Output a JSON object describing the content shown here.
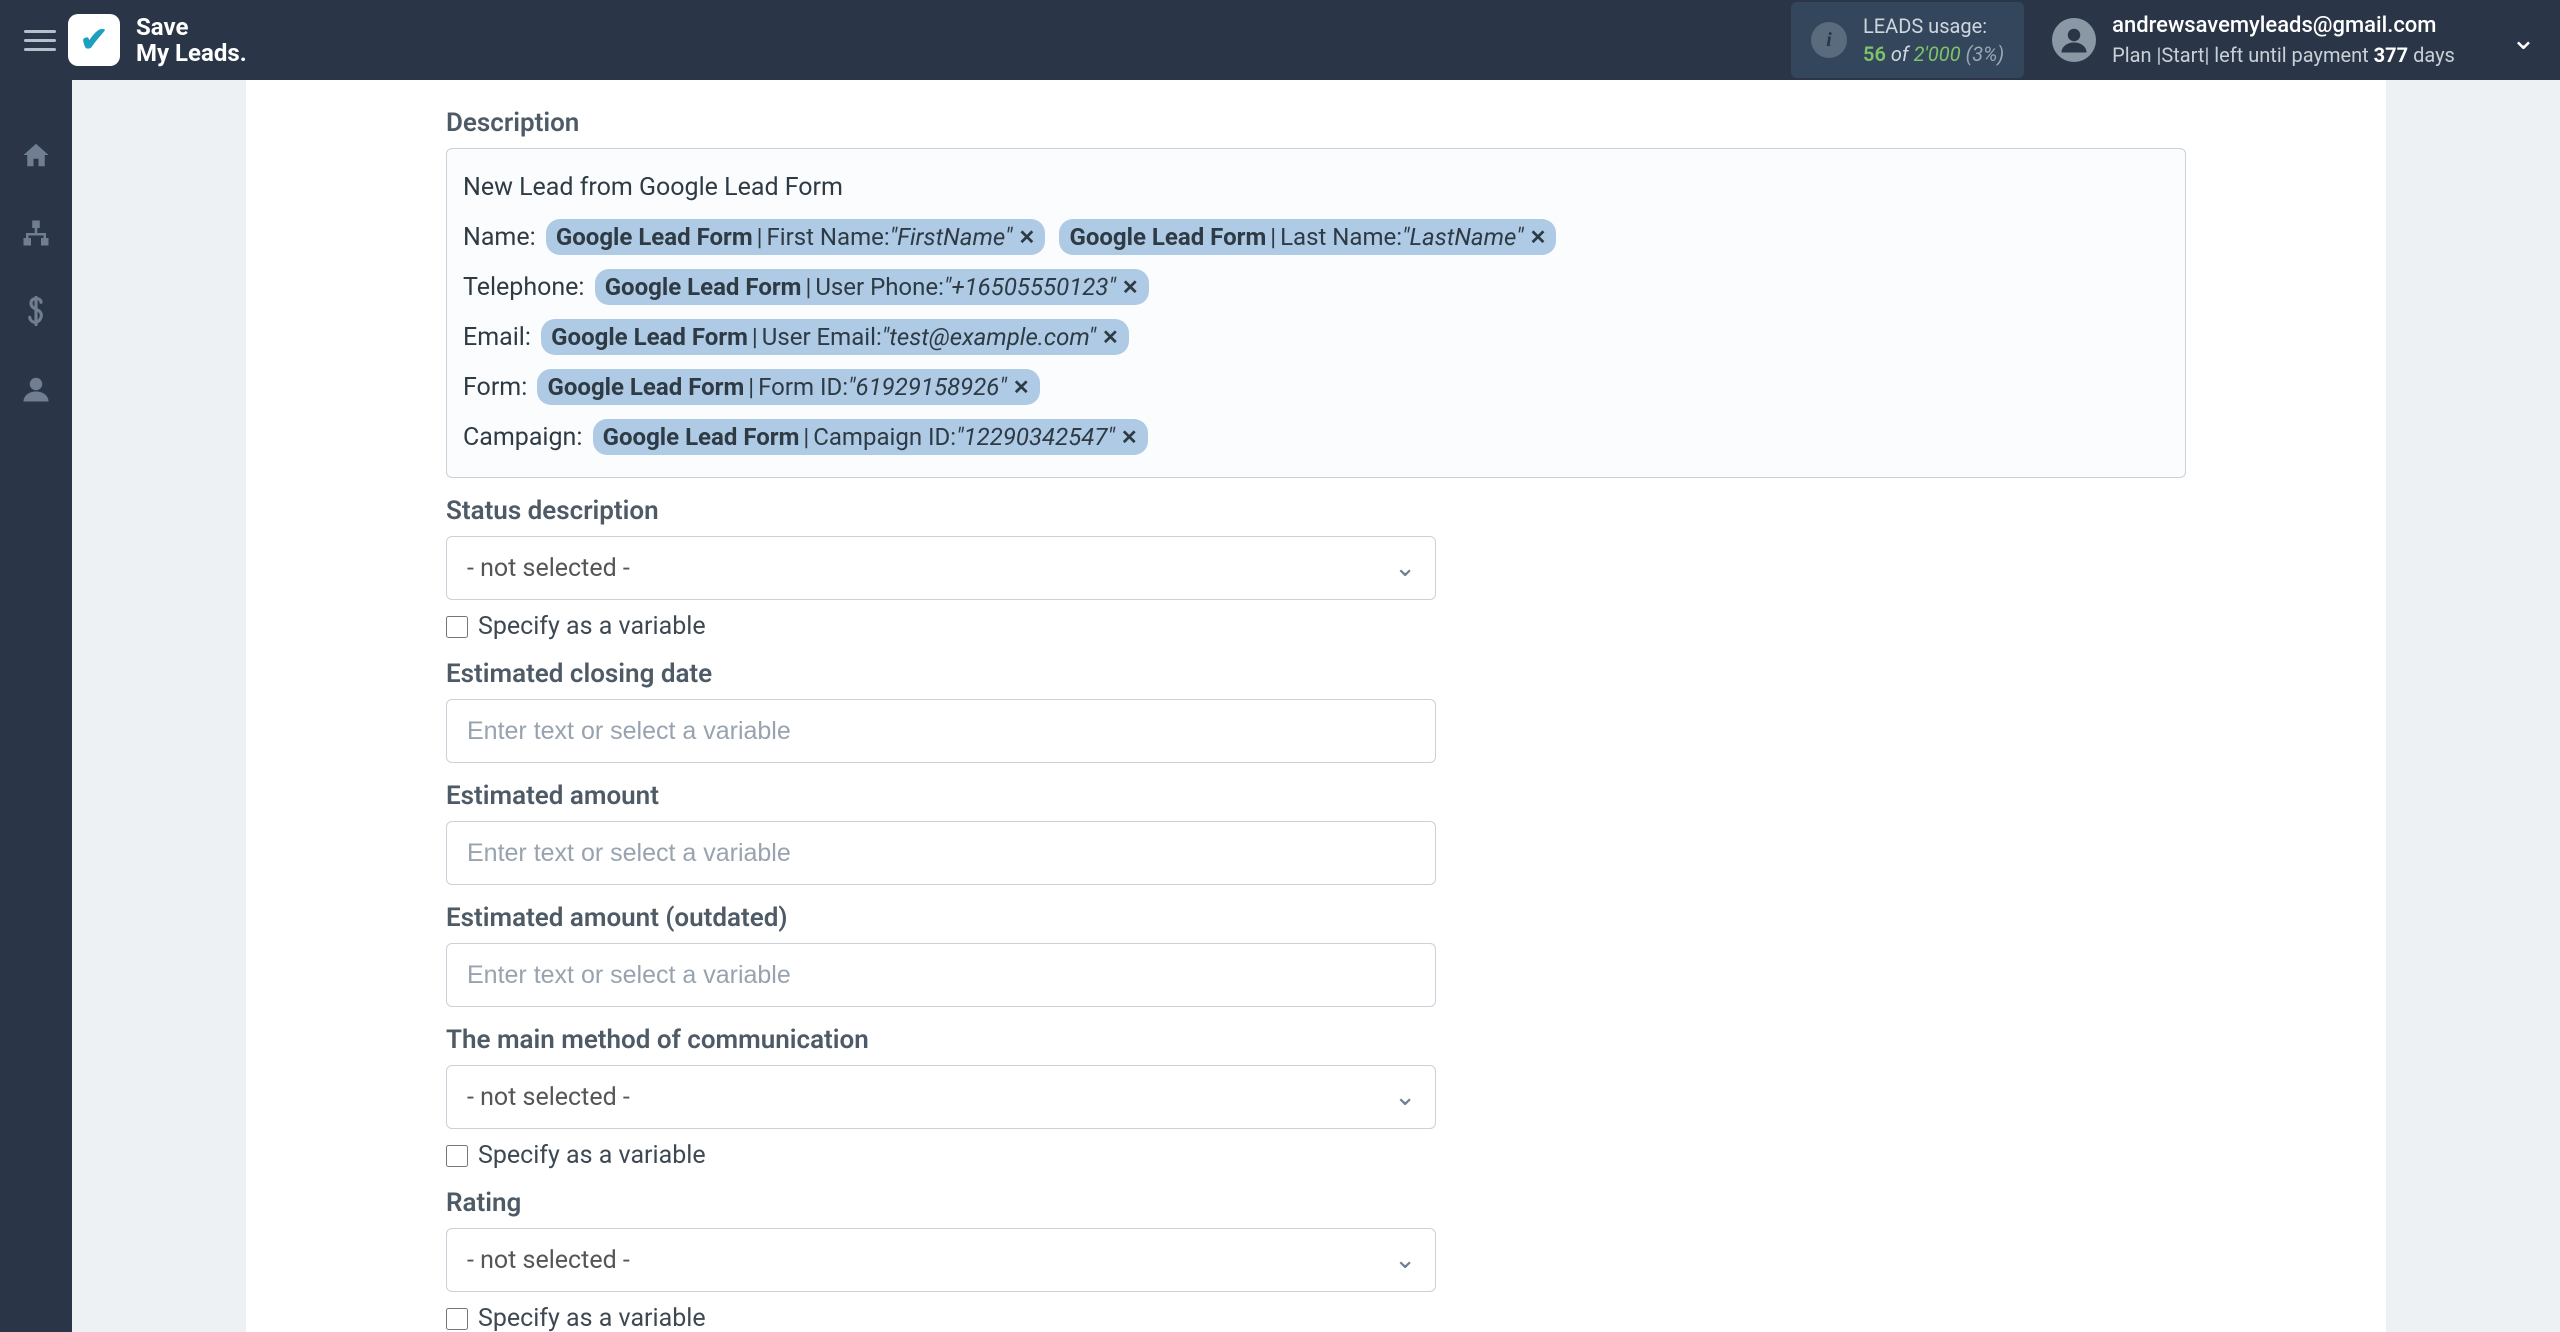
{
  "brand": {
    "line1": "Save",
    "line2": "My Leads."
  },
  "leads_usage": {
    "title": "LEADS usage:",
    "used": "56",
    "of_word": "of",
    "total": "2'000",
    "pct": "(3%)"
  },
  "user": {
    "email": "andrewsavemyleads@gmail.com",
    "plan_prefix": "Plan |Start| left until payment",
    "days": "377",
    "days_suffix": "days"
  },
  "description": {
    "label": "Description",
    "lead_line": "New Lead from Google Lead Form",
    "rows": [
      {
        "label": "Name:",
        "tags": [
          {
            "source": "Google Lead Form",
            "field": "First Name:",
            "value": "\"FirstName\""
          },
          {
            "source": "Google Lead Form",
            "field": "Last Name:",
            "value": "\"LastName\""
          }
        ]
      },
      {
        "label": "Telephone:",
        "tags": [
          {
            "source": "Google Lead Form",
            "field": "User Phone:",
            "value": "\"+16505550123\""
          }
        ]
      },
      {
        "label": "Email:",
        "tags": [
          {
            "source": "Google Lead Form",
            "field": "User Email:",
            "value": "\"test@example.com\""
          }
        ]
      },
      {
        "label": "Form:",
        "tags": [
          {
            "source": "Google Lead Form",
            "field": "Form ID:",
            "value": "\"61929158926\""
          }
        ]
      },
      {
        "label": "Campaign:",
        "tags": [
          {
            "source": "Google Lead Form",
            "field": "Campaign ID:",
            "value": "\"12290342547\""
          }
        ]
      }
    ]
  },
  "fields": {
    "status_description": {
      "label": "Status description",
      "value": "- not selected -",
      "specify": "Specify as a variable"
    },
    "estimated_closing_date": {
      "label": "Estimated closing date",
      "placeholder": "Enter text or select a variable"
    },
    "estimated_amount": {
      "label": "Estimated amount",
      "placeholder": "Enter text or select a variable"
    },
    "estimated_amount_outdated": {
      "label": "Estimated amount (outdated)",
      "placeholder": "Enter text or select a variable"
    },
    "main_communication": {
      "label": "The main method of communication",
      "value": "- not selected -",
      "specify": "Specify as a variable"
    },
    "rating": {
      "label": "Rating",
      "value": "- not selected -",
      "specify": "Specify as a variable"
    }
  }
}
